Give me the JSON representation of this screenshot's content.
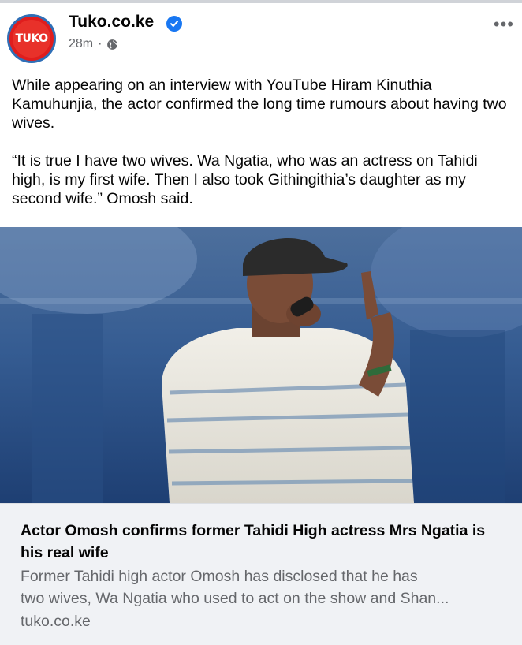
{
  "header": {
    "avatar_text": "TUKO",
    "page_name": "Tuko.co.ke",
    "time": "28m",
    "separator": "·",
    "privacy_icon": "globe-icon",
    "verified_icon": "verified-check-icon",
    "more_icon": "more-dots-icon"
  },
  "post": {
    "paragraph1": "While appearing on an interview with YouTube Hiram Kinuthia Kamuhunjia, the actor confirmed the long time rumours about having two wives.",
    "paragraph2": "“It is true I have two wives. Wa Ngatia, who was an actress on Tahidi high, is my first wife. Then I also took Githingithia’s daughter as my second wife.” Omosh said."
  },
  "link_card": {
    "title": "Actor Omosh confirms former Tahidi High actress Mrs Ngatia is his real wife",
    "description_line1": "Former Tahidi high actor Omosh has disclosed that he has",
    "description_line2": "two wives, Wa Ngatia who used to act on the show and Shan...",
    "domain": "tuko.co.ke"
  },
  "colors": {
    "brand_red": "#e01d1d",
    "verified_blue": "#1877f2",
    "muted_text": "#65676b",
    "card_bg": "#f0f2f5"
  }
}
